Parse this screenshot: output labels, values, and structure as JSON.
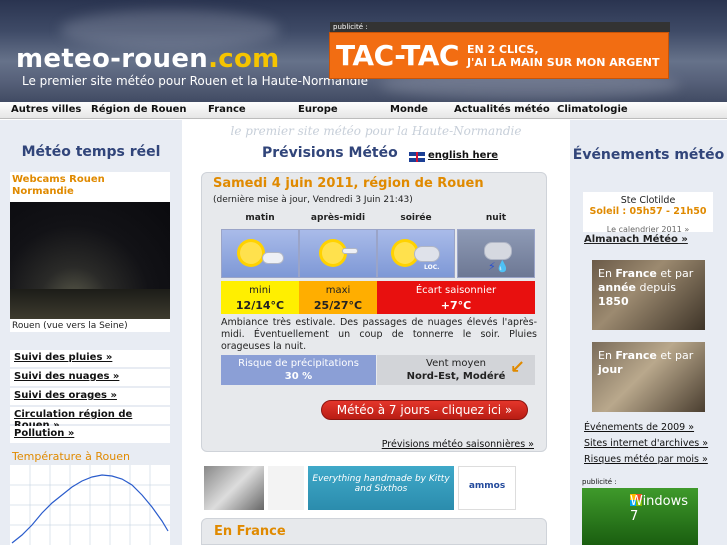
{
  "header": {
    "logo_main": "meteo-rouen",
    "logo_domain": ".com",
    "tagline": "Le premier site météo pour Rouen et la Haute-Normandie",
    "ad_label": "publicité :",
    "ad_big": "TAC-TAC",
    "ad_line1": "EN 2 CLICS,",
    "ad_line2": "J'AI LA MAIN SUR MON ARGENT"
  },
  "nav": [
    "Autres villes",
    "Région de Rouen",
    "France",
    "Europe",
    "Monde",
    "Actualités météo",
    "Climatologie"
  ],
  "left": {
    "title": "Météo temps réel",
    "webcam_title": "Webcams Rouen Normandie",
    "webcam_caption": "Rouen (vue vers la Seine)",
    "links": [
      "Suivi des pluies »",
      "Suivi des nuages »",
      "Suivi des orages »",
      "Circulation région de Rouen »",
      "Pollution »"
    ],
    "temp_title": "Température à Rouen"
  },
  "center": {
    "tagline": "le premier site météo pour la Haute-Normandie",
    "title": "Prévisions Météo",
    "english": "english here",
    "date": "Samedi 4 juin 2011, région de Rouen",
    "update": "(dernière mise à jour, Vendredi 3 Juin 21:43)",
    "periods": [
      "matin",
      "après-midi",
      "soirée",
      "nuit"
    ],
    "loc_badge": "LOC.",
    "mini_label": "mini",
    "mini_value": "12/14°C",
    "maxi_label": "maxi",
    "maxi_value": "25/27°C",
    "ecart_label": "Écart saisonnier",
    "ecart_value": "+7°C",
    "text": "Ambiance très estivale. Des passages de nuages élevés l'après-midi. Éventuellement un coup de tonnerre le soir. Pluies orageuses la nuit.",
    "risk_label": "Risque de précipitations",
    "risk_value": "30 %",
    "wind_label": "Vent moyen",
    "wind_value": "Nord-Est, Modéré",
    "button_7days": "Météo à 7 jours - cliquez ici »",
    "seasonal_link": "Prévisions météo saisonnières »",
    "ad_banner_text": "Everything handmade by Kitty and Sixthos",
    "ad_banner_brand": "ammos",
    "en_france": "En France"
  },
  "right": {
    "title": "Événements météo",
    "saint": "Ste Clotilde",
    "sun_times": "Soleil : 05h57 - 21h50",
    "calendar": "Le calendrier 2011 »",
    "almanach": "Almanach Météo »",
    "photo1": {
      "pre": "En ",
      "b1": "France",
      "mid": " et par ",
      "b2": "année",
      "post": " depuis ",
      "b3": "1850"
    },
    "photo2": {
      "pre": "En ",
      "b1": "France",
      "mid": " et par ",
      "b2": "jour"
    },
    "links": [
      "Événements de 2009 »",
      "Sites internet d'archives »",
      "Risques météo par mois »"
    ],
    "ad_label": "publicité :",
    "ad_text": "Windows 7"
  }
}
